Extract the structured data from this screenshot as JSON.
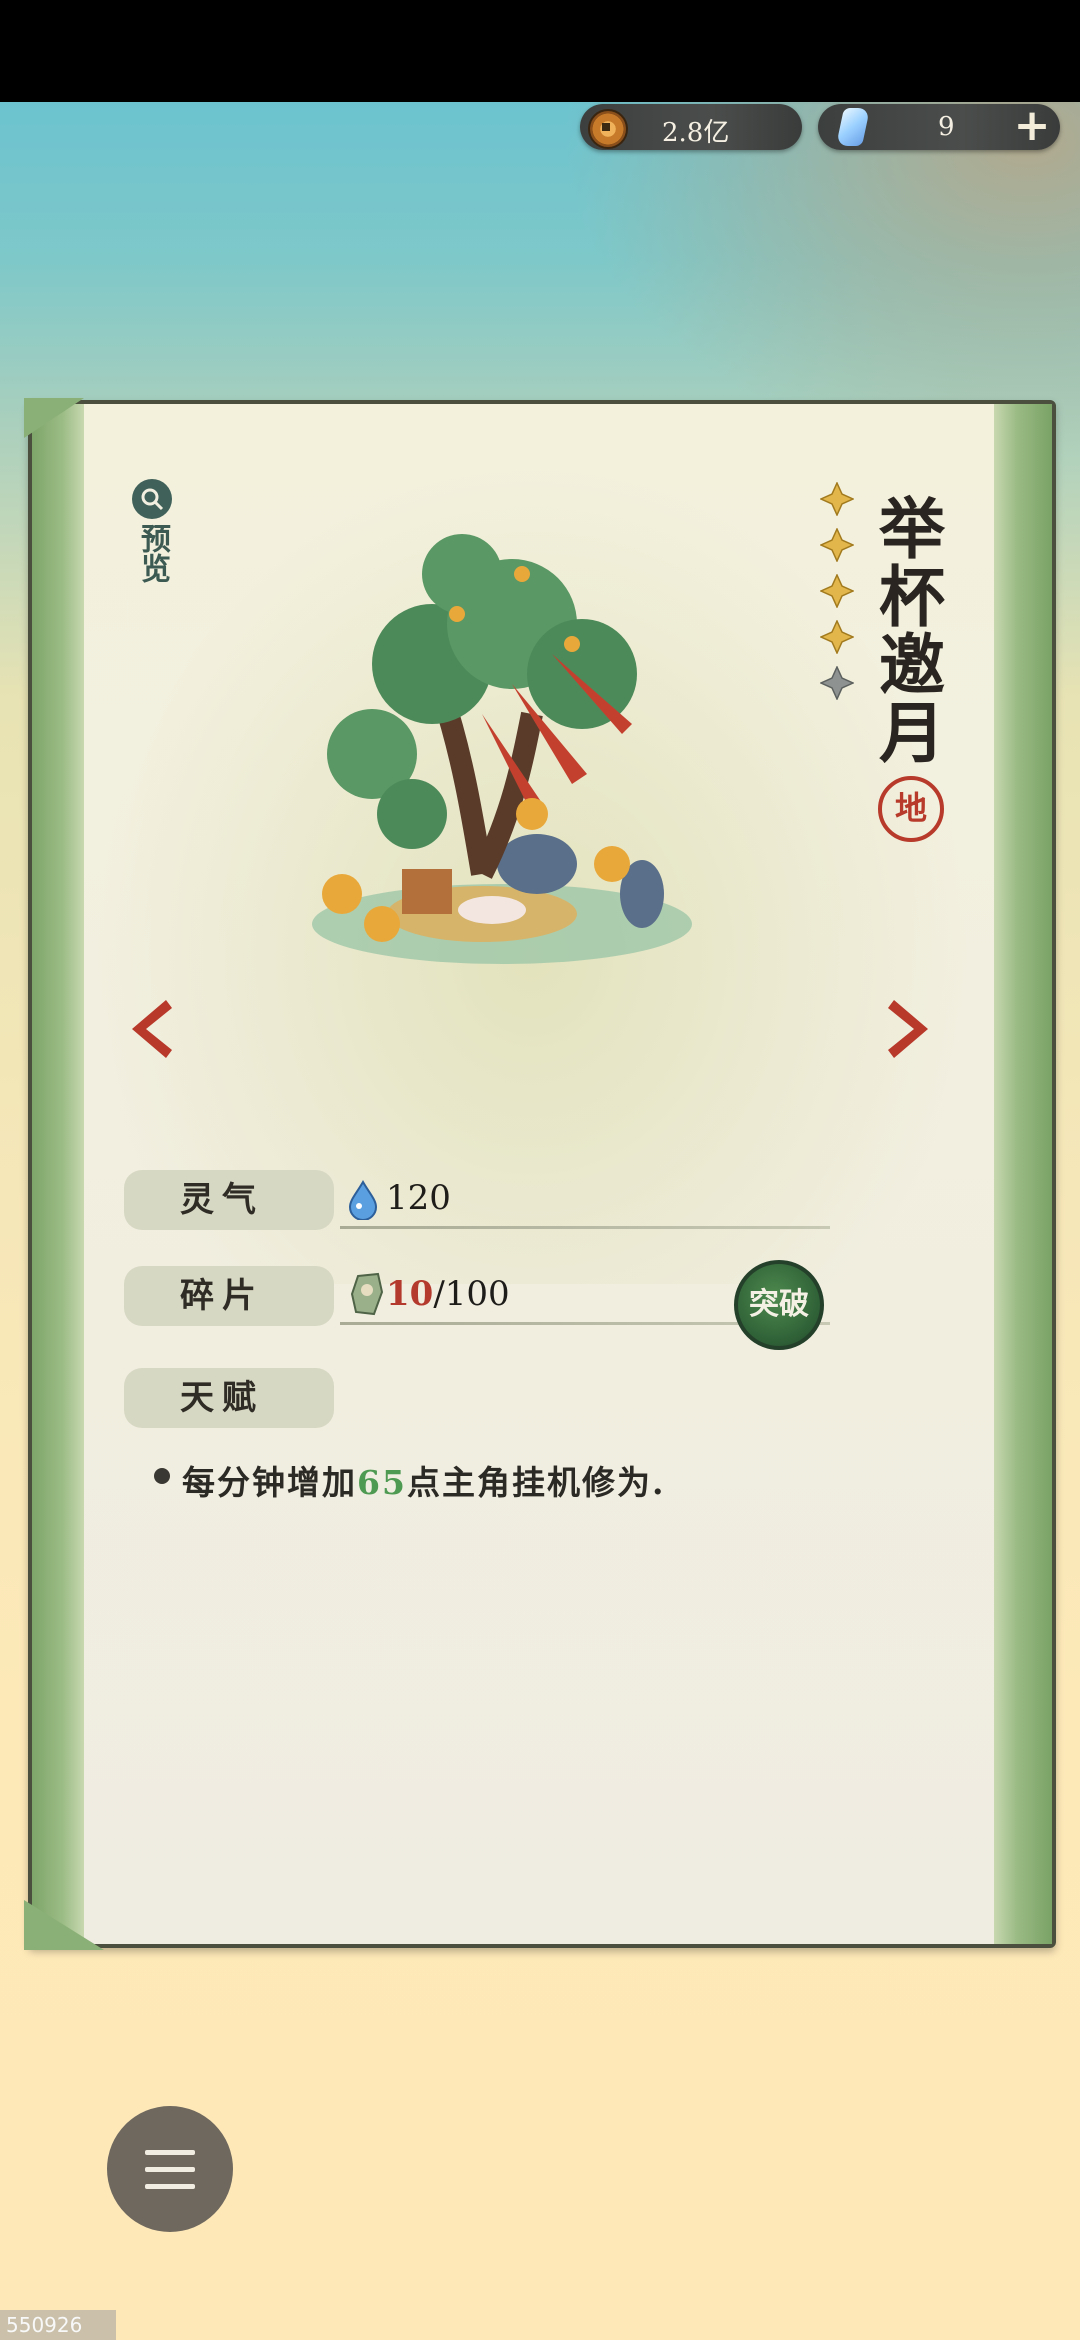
{
  "header": {
    "coins": "2.8亿",
    "gems": "9",
    "coin_icon": "copper-coin-icon",
    "gem_icon": "spirit-crystal-icon",
    "add_icon": "plus-icon"
  },
  "item": {
    "name": "举杯邀月",
    "grade": "地",
    "stars_total": 5,
    "stars_filled": 4,
    "preview_label": "预览"
  },
  "stats": {
    "qi_label": "灵气",
    "qi_value": "120",
    "fragment_label": "碎片",
    "fragment_current": "10",
    "fragment_total": "/100",
    "break_label": "突破",
    "talent_label": "天赋"
  },
  "talent": {
    "prefix": "每分钟增加",
    "number": "65",
    "suffix": "点主角挂机修为."
  },
  "footer": {
    "watermark": "550926"
  },
  "colors": {
    "accent_red": "#b33a2c",
    "talent_green": "#4e9a52",
    "break_green": "#2e5f36"
  }
}
